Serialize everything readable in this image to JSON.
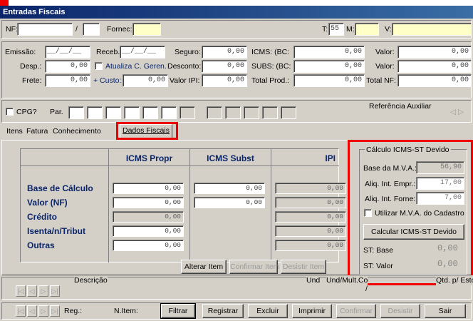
{
  "window": {
    "title": "Entradas Fiscais"
  },
  "header": {
    "nf_label": "NF:",
    "sep": "/",
    "fornec_label": "Fornec:",
    "t_label": "T:",
    "t_value": "55",
    "m_label": "M:",
    "v_label": "V:"
  },
  "values": {
    "date_mask": "__/__/__",
    "emissao_label": "Emissão:",
    "receb_label": "Receb.:",
    "seguro_label": "Seguro:",
    "seguro": "0,00",
    "icms_bc_label": "ICMS: (BC:",
    "icms_bc": "0,00",
    "valor_label": "Valor:",
    "valor1": "0,00",
    "valor2": "0,00",
    "desp_label": "Desp.:",
    "desp": "0,00",
    "atualiza_label": "Atualiza C. Geren.",
    "desconto_label": "Desconto:",
    "desconto": "0,00",
    "subs_bc_label": "SUBS: (BC:",
    "subs_bc": "0,00",
    "frete_label": "Frete:",
    "frete": "0,00",
    "custo_label": "+ Custo:",
    "custo": "0,00",
    "valor_ipi_label": "Valor IPI:",
    "valor_ipi": "0,00",
    "total_prod_label": "Total Prod.:",
    "total_prod": "0,00",
    "total_nf_label": "Total NF:",
    "total_nf": "0,00"
  },
  "cpg": {
    "label": "CPG?",
    "par_label": "Par.",
    "ref_label": "Referência Auxiliar",
    "ref_nav": "◁ ▷"
  },
  "tabs": [
    "Itens",
    "Fatura",
    "Conhecimento",
    "Dados Fiscais"
  ],
  "fiscal": {
    "headers": [
      "ICMS Propr",
      "ICMS Subst",
      "IPI"
    ],
    "rows": [
      {
        "label": "Base de Cálculo",
        "propr": "0,00",
        "subst": "0,00",
        "ipi": "0,00"
      },
      {
        "label": "Valor (NF)",
        "propr": "0,00",
        "subst": "0,00",
        "ipi": "0,00"
      },
      {
        "label": "Crédito",
        "propr": "0,00",
        "subst": "",
        "ipi": "0,00"
      },
      {
        "label": "Isenta/n/Tribut",
        "propr": "0,00",
        "subst": "",
        "ipi": "0,00"
      },
      {
        "label": "Outras",
        "propr": "0,00",
        "subst": "",
        "ipi": "0,00"
      }
    ]
  },
  "buttons": {
    "alterar": "Alterar Item",
    "confirmar_item": "Confirmar Item",
    "desistir_item": "Desistir Item"
  },
  "calculo": {
    "title": "Cálculo ICMS-ST Devido",
    "base_mva_label": "Base da M.V.A.:",
    "base_mva": "56,90",
    "aliq_empr_label": "Aliq. Int. Empr.:",
    "aliq_empr": "17,00",
    "aliq_forne_label": "Aliq. Int. Forne:",
    "aliq_forne": "7,00",
    "utilizar_label": "Utilizar M.V.A. do Cadastro",
    "button": "Calcular ICMS-ST Devido",
    "st_base_label": "ST: Base",
    "st_base": "0,00",
    "st_valor_label": "ST: Valor",
    "st_valor": "0,00"
  },
  "nav": {
    "first": "|◁",
    "prev": "◁",
    "next": "▷",
    "last": "▷|"
  },
  "items": {
    "descricao_label": "Descrição",
    "und_label": "Und",
    "und_mult_label": "Und/Mult.Co",
    "und_mult_value": "/",
    "qtd_label": "Qtd. p/ Estoq."
  },
  "toolbar": {
    "reg_label": "Reg.:",
    "nitem_label": "N.Item:",
    "filtrar": "Filtrar",
    "registrar": "Registrar",
    "excluir": "Excluir",
    "imprimir": "Imprimir",
    "confirmar": "Confirmar",
    "desistir": "Desistir",
    "sair": "Sair"
  }
}
